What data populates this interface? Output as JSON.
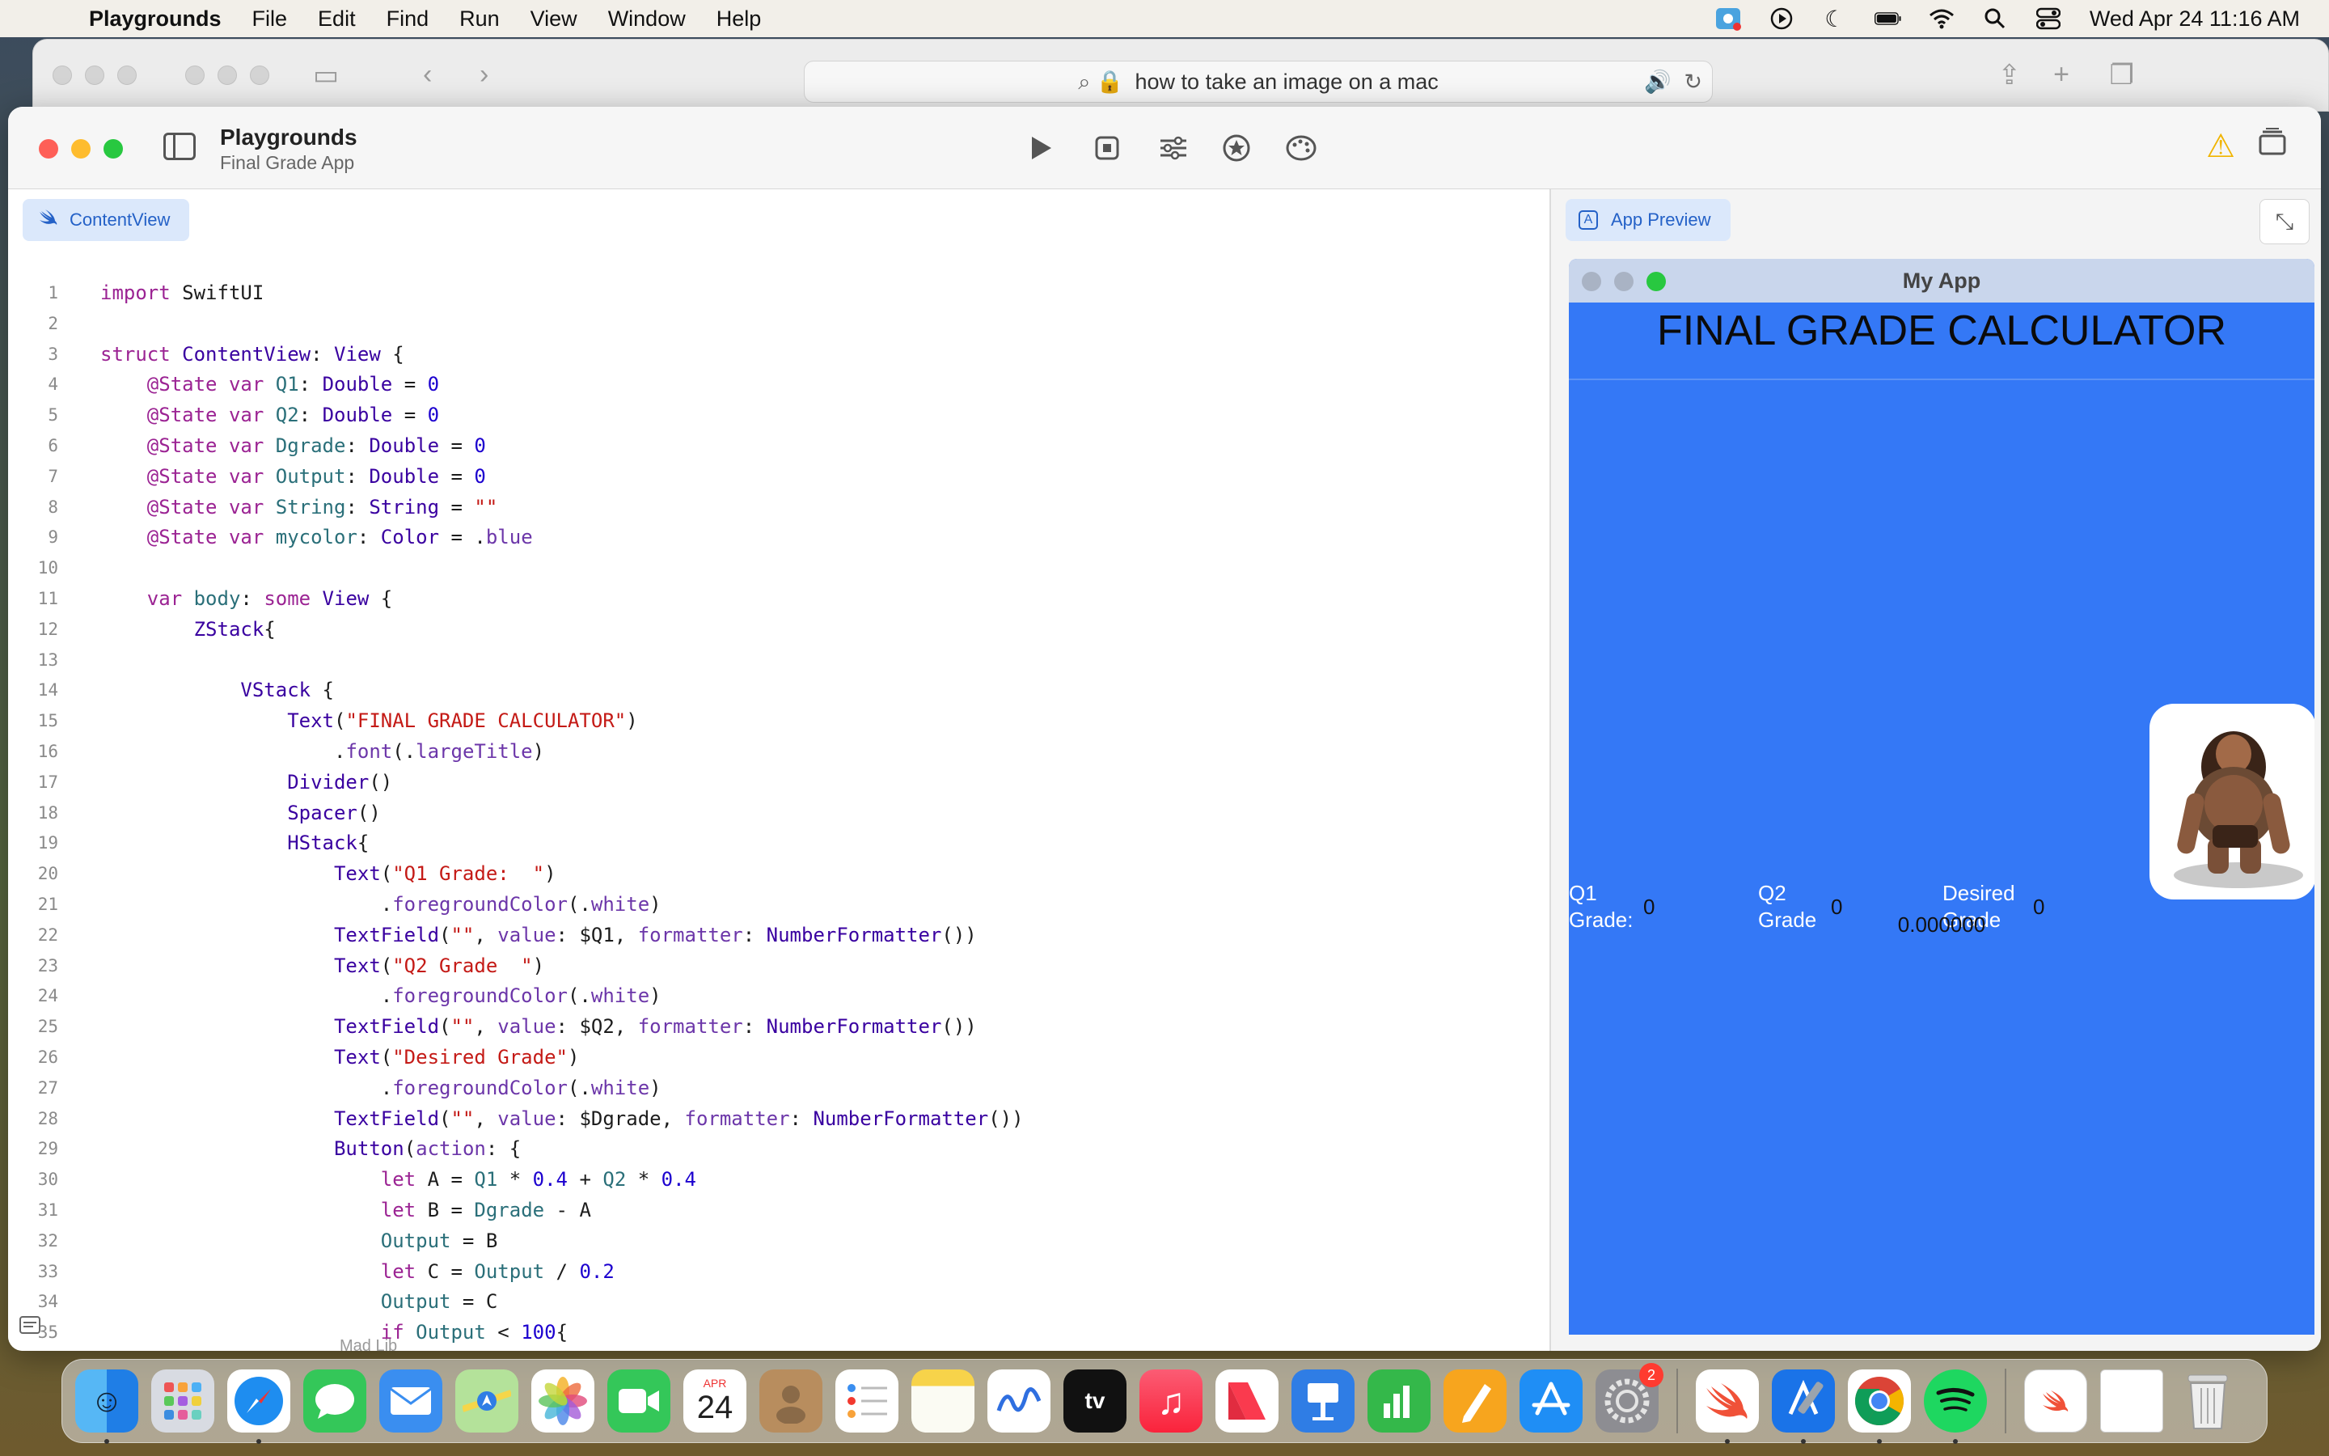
{
  "menubar": {
    "app_name": "Playgrounds",
    "items": [
      "File",
      "Edit",
      "Find",
      "Run",
      "View",
      "Window",
      "Help"
    ],
    "clock": "Wed Apr 24  11:16 AM"
  },
  "safari": {
    "address": "how to take an image on a mac"
  },
  "window": {
    "title": "Playgrounds",
    "subtitle": "Final Grade App"
  },
  "editor": {
    "file_tab": "ContentView",
    "faded_label": "Mad Lib",
    "lines": [
      {
        "n": "1"
      },
      {
        "n": "2"
      },
      {
        "n": "3"
      },
      {
        "n": "4"
      },
      {
        "n": "5"
      },
      {
        "n": "6"
      },
      {
        "n": "7"
      },
      {
        "n": "8"
      },
      {
        "n": "9"
      },
      {
        "n": "10"
      },
      {
        "n": "11"
      },
      {
        "n": "12"
      },
      {
        "n": "13"
      },
      {
        "n": "14"
      },
      {
        "n": "15"
      },
      {
        "n": "16"
      },
      {
        "n": "17"
      },
      {
        "n": "18"
      },
      {
        "n": "19"
      },
      {
        "n": "20"
      },
      {
        "n": "21"
      },
      {
        "n": "22"
      },
      {
        "n": "23"
      },
      {
        "n": "24"
      },
      {
        "n": "25"
      },
      {
        "n": "26"
      },
      {
        "n": "27"
      },
      {
        "n": "28"
      },
      {
        "n": "29"
      },
      {
        "n": "30"
      },
      {
        "n": "31"
      },
      {
        "n": "32"
      },
      {
        "n": "33"
      },
      {
        "n": "34"
      },
      {
        "n": "35"
      }
    ],
    "code": {
      "l1_a": "import",
      "l1_b": " SwiftUI",
      "l3_a": "struct",
      "l3_b": " ContentView",
      "l3_c": ": ",
      "l3_d": "View",
      "l3_e": " {",
      "l4_a": "    @State var",
      "l4_b": " Q1",
      "l4_c": ": ",
      "l4_d": "Double",
      "l4_e": " = ",
      "l4_f": "0",
      "l5_a": "    @State var",
      "l5_b": " Q2",
      "l5_c": ": ",
      "l5_d": "Double",
      "l5_e": " = ",
      "l5_f": "0",
      "l6_a": "    @State var",
      "l6_b": " Dgrade",
      "l6_c": ": ",
      "l6_d": "Double",
      "l6_e": " = ",
      "l6_f": "0",
      "l7_a": "    @State var",
      "l7_b": " Output",
      "l7_c": ": ",
      "l7_d": "Double",
      "l7_e": " = ",
      "l7_f": "0",
      "l8_a": "    @State var",
      "l8_b": " String",
      "l8_c": ": ",
      "l8_d": "String",
      "l8_e": " = ",
      "l8_f": "\"\"",
      "l9_a": "    @State var",
      "l9_b": " mycolor",
      "l9_c": ": ",
      "l9_d": "Color",
      "l9_e": " = .",
      "l9_f": "blue",
      "l11_a": "    var",
      "l11_b": " body",
      "l11_c": ": ",
      "l11_d": "some",
      "l11_e": " View",
      "l11_f": " {",
      "l12_a": "        ZStack",
      "l12_b": "{",
      "l14_a": "            VStack",
      "l14_b": " {",
      "l15_a": "                Text",
      "l15_b": "(",
      "l15_c": "\"FINAL GRADE CALCULATOR\"",
      "l15_d": ")",
      "l16_a": "                    .",
      "l16_b": "font",
      "l16_c": "(.",
      "l16_d": "largeTitle",
      "l16_e": ")",
      "l17_a": "                Divider",
      "l17_b": "()",
      "l18_a": "                Spacer",
      "l18_b": "()",
      "l19_a": "                HStack",
      "l19_b": "{",
      "l20_a": "                    Text",
      "l20_b": "(",
      "l20_c": "\"Q1 Grade:  \"",
      "l20_d": ")",
      "l21_a": "                        .",
      "l21_b": "foregroundColor",
      "l21_c": "(.",
      "l21_d": "white",
      "l21_e": ")",
      "l22_a": "                    TextField",
      "l22_b": "(",
      "l22_c": "\"\"",
      "l22_d": ", ",
      "l22_e": "value",
      "l22_f": ": $Q1, ",
      "l22_g": "formatter",
      "l22_h": ": ",
      "l22_i": "NumberFormatter",
      "l22_j": "())",
      "l23_a": "                    Text",
      "l23_b": "(",
      "l23_c": "\"Q2 Grade  \"",
      "l23_d": ")",
      "l24_a": "                        .",
      "l24_b": "foregroundColor",
      "l24_c": "(.",
      "l24_d": "white",
      "l24_e": ")",
      "l25_a": "                    TextField",
      "l25_b": "(",
      "l25_c": "\"\"",
      "l25_d": ", ",
      "l25_e": "value",
      "l25_f": ": $Q2, ",
      "l25_g": "formatter",
      "l25_h": ": ",
      "l25_i": "NumberFormatter",
      "l25_j": "())",
      "l26_a": "                    Text",
      "l26_b": "(",
      "l26_c": "\"Desired Grade\"",
      "l26_d": ")",
      "l27_a": "                        .",
      "l27_b": "foregroundColor",
      "l27_c": "(.",
      "l27_d": "white",
      "l27_e": ")",
      "l28_a": "                    TextField",
      "l28_b": "(",
      "l28_c": "\"\"",
      "l28_d": ", ",
      "l28_e": "value",
      "l28_f": ": $Dgrade, ",
      "l28_g": "formatter",
      "l28_h": ": ",
      "l28_i": "NumberFormatter",
      "l28_j": "())",
      "l29_a": "                    Button",
      "l29_b": "(",
      "l29_c": "action",
      "l29_d": ": {",
      "l30_a": "                        let",
      "l30_b": " A = ",
      "l30_c": "Q1",
      "l30_d": " * ",
      "l30_e": "0.4",
      "l30_f": " + ",
      "l30_g": "Q2",
      "l30_h": " * ",
      "l30_i": "0.4",
      "l31_a": "                        let",
      "l31_b": " B = ",
      "l31_c": "Dgrade",
      "l31_d": " - A",
      "l32_a": "                        Output",
      "l32_b": " = B",
      "l33_a": "                        let",
      "l33_b": " C = ",
      "l33_c": "Output",
      "l33_d": " / ",
      "l33_e": "0.2",
      "l34_a": "                        Output",
      "l34_b": " = C",
      "l35_a": "                        if",
      "l35_b": " Output",
      "l35_c": " < ",
      "l35_d": "100",
      "l35_e": "{"
    }
  },
  "preview": {
    "tab_label": "App Preview",
    "window_title": "My App",
    "big_title": "FINAL GRADE CALCULATOR",
    "q1_label": "Q1\nGrade:",
    "q1_value": "0",
    "q2_label": "Q2\nGrade",
    "q2_value": "0",
    "desired_label": "Desired\nGrade",
    "desired_value": "0",
    "result": "0.000000",
    "background_color": "#3478f6"
  },
  "dock": {
    "calendar_month": "APR",
    "calendar_day": "24",
    "settings_badge": "2",
    "apps": [
      "Finder",
      "Launchpad",
      "Safari",
      "Messages",
      "Mail",
      "Maps",
      "Photos",
      "FaceTime",
      "Calendar",
      "Contacts",
      "Reminders",
      "Notes",
      "Freeform",
      "TV",
      "Music",
      "News",
      "Keynote",
      "Numbers",
      "Pages",
      "App Store",
      "System Settings",
      "Swift Playgrounds",
      "Xcode",
      "Chrome",
      "Spotify",
      "Document",
      "Folder",
      "Trash"
    ]
  }
}
